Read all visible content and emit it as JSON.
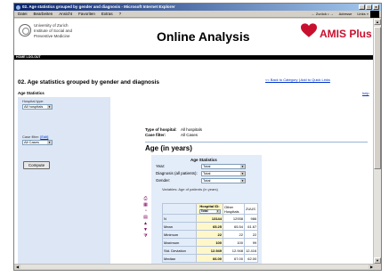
{
  "window": {
    "title": "02. Age statistics grouped by gender and diagnosis - Microsoft Internet Explorer",
    "buttons": {
      "minimize": "_",
      "maximize": "□",
      "close": "x"
    }
  },
  "menubar": {
    "items": [
      "Datei",
      "Bearbeiten",
      "Ansicht",
      "Favoriten",
      "Extras",
      "?"
    ],
    "right": [
      "← Zurück • →",
      "Adresse",
      "Links »"
    ]
  },
  "header": {
    "uni_lines": [
      "University of Zurich",
      "Institute of Social and",
      "Preventive Medicine"
    ],
    "title": "Online Analysis",
    "brand": "AMIS Plus",
    "brand_color": "#c8102e"
  },
  "navstrip": {
    "label": "HOME  LOG-OUT"
  },
  "page": {
    "heading": "02. Age statistics grouped by gender and diagnosis",
    "link_back": "<< Back to Category",
    "link_sep": "|",
    "link_quick": "Add to Quick Links",
    "help": "help"
  },
  "sidebar": {
    "title": "Age Statistics",
    "hospital_label": "Hospital type:",
    "hospital_value": "All hospitals",
    "case_label": "Case filter:",
    "case_link": "[Edit]",
    "case_value": "All Cases",
    "compute": "Compute"
  },
  "info": {
    "hospital_key": "Type of hospital:",
    "hospital_val": "All hospitals",
    "case_key": "Case filter:",
    "case_val": "All Cases"
  },
  "section": {
    "title": "Age (in years)"
  },
  "stats": {
    "heading": "Age Statistics",
    "rows": [
      {
        "label": "Year:",
        "value": "Total"
      },
      {
        "label": "Diagnosis (all patients):",
        "value": "Total"
      },
      {
        "label": "Gender:",
        "value": "Total"
      }
    ],
    "variables": "Variables: Age of patients (in years)",
    "table": {
      "hospital_header": "Hospital ID:",
      "hospital_select": "Total",
      "other_header": "Other Hospitals",
      "zuus_header": "ZUUS",
      "rows": [
        {
          "label": "N",
          "hosp": "13144",
          "other": "12938",
          "zuus": "986"
        },
        {
          "label": "Mean",
          "hosp": "65.25",
          "other": "65.54",
          "zuus": "61.67"
        },
        {
          "label": "Minimum",
          "hosp": "22",
          "other": "22",
          "zuus": "22"
        },
        {
          "label": "Maximum",
          "hosp": "100",
          "other": "100",
          "zuus": "99"
        },
        {
          "label": "Std. Deviation",
          "hosp": "12.949",
          "other": "12.948",
          "zuus": "12.416"
        },
        {
          "label": "Median",
          "hosp": "66.00",
          "other": "67.00",
          "zuus": "62.00"
        }
      ]
    }
  },
  "icons": [
    "print-icon",
    "excel-icon",
    "chart-icon",
    "table-icon",
    "arrow-up-icon",
    "arrow-down-icon",
    "funnel-icon"
  ]
}
